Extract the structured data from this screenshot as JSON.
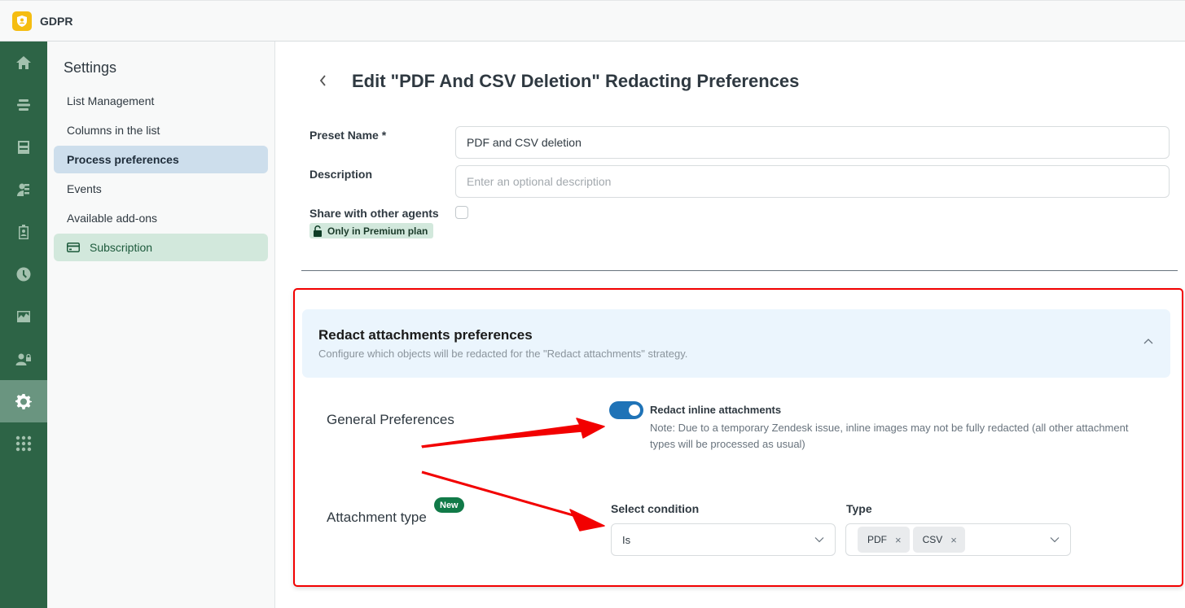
{
  "app": {
    "title": "GDPR",
    "logo_icon": "shield-user-icon",
    "logo_color": "#f5bd11"
  },
  "rail": {
    "items": [
      {
        "name": "home",
        "icon": "home-icon",
        "active": false
      },
      {
        "name": "list",
        "icon": "list-lines-icon",
        "active": false
      },
      {
        "name": "archive",
        "icon": "archive-icon",
        "active": false
      },
      {
        "name": "redact-user",
        "icon": "user-redact-icon",
        "active": false
      },
      {
        "name": "badge",
        "icon": "id-badge-icon",
        "active": false
      },
      {
        "name": "history",
        "icon": "clock-icon",
        "active": false
      },
      {
        "name": "reports",
        "icon": "chart-icon",
        "active": false
      },
      {
        "name": "user-lock",
        "icon": "user-lock-icon",
        "active": false
      },
      {
        "name": "settings",
        "icon": "gear-icon",
        "active": true
      },
      {
        "name": "apps",
        "icon": "grid-dots-icon",
        "active": false
      }
    ],
    "color": "#2d6446",
    "active_color": "#6a9580"
  },
  "subnav": {
    "title": "Settings",
    "items": [
      {
        "label": "List Management"
      },
      {
        "label": "Columns in the list"
      },
      {
        "label": "Process preferences",
        "selected": true
      },
      {
        "label": "Events"
      },
      {
        "label": "Available add-ons"
      },
      {
        "label": "Subscription",
        "icon": "credit-card-icon",
        "highlight": true
      }
    ]
  },
  "page": {
    "title": "Edit \"PDF And CSV Deletion\" Redacting Preferences",
    "back_icon": "chevron-left-icon"
  },
  "form": {
    "preset_name_label": "Preset Name *",
    "preset_name_value": "PDF and CSV deletion",
    "description_label": "Description",
    "description_placeholder": "Enter an optional description",
    "description_value": "",
    "share_label": "Share with other agents",
    "share_checked": false,
    "premium_badge": "Only in Premium plan"
  },
  "panel": {
    "title": "Redact attachments preferences",
    "subtitle": "Configure which objects will be redacted for the \"Redact attachments\" strategy.",
    "expanded": true,
    "general": {
      "label": "General Preferences",
      "toggle_label": "Redact inline attachments",
      "toggle_on": true,
      "note": "Note: Due to a temporary Zendesk issue, inline images may not be fully redacted (all other attachment types will be processed as usual)"
    },
    "attachment_type": {
      "label": "Attachment type",
      "badge": "New",
      "condition_label": "Select condition",
      "condition_value": "Is",
      "type_label": "Type",
      "type_tags": [
        "PDF",
        "CSV"
      ],
      "tag_remove_glyph": "×"
    }
  },
  "annotations": {
    "highlight_color": "#f20000",
    "arrow_count": 2
  }
}
